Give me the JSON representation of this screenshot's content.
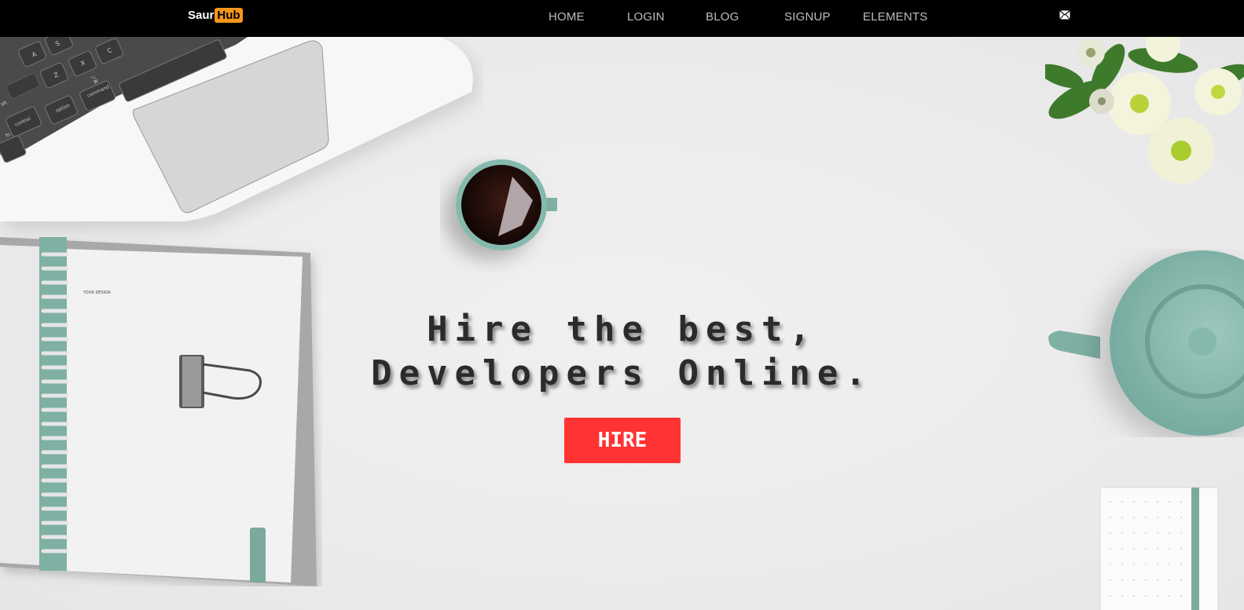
{
  "brand": {
    "part1": "Saur",
    "part2": "Hub"
  },
  "nav": {
    "items": [
      {
        "label": "HOME"
      },
      {
        "label": "LOGIN"
      },
      {
        "label": "BLOG"
      },
      {
        "label": "SIGNUP"
      },
      {
        "label": "ELEMENTS"
      }
    ],
    "contact_icon": "mail-icon"
  },
  "hero": {
    "line1": "Hire the best,",
    "line2": "Developers Online.",
    "cta_label": "HIRE",
    "notebook_label": "YOUR DESIGN"
  },
  "keyboard_keys": [
    "A",
    "S",
    "Z",
    "X",
    "C",
    "⌘",
    "command",
    "option",
    "control",
    "alt",
    "fn",
    "⌥"
  ],
  "colors": {
    "navbar_bg": "#000000",
    "brand_accent": "#f7971d",
    "cta_bg": "#ff3333",
    "background": "#ececec",
    "teal_accent": "#8fc1b5"
  }
}
